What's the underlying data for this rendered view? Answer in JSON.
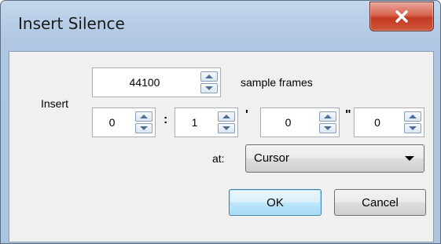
{
  "window": {
    "title": "Insert Silence",
    "close_icon": "close-icon",
    "accent": "#c23a22"
  },
  "form": {
    "insert_label": "Insert",
    "frames": {
      "value": "44100",
      "unit_label": "sample frames"
    },
    "time": {
      "hours": "0",
      "sep1": ":",
      "minutes": "1",
      "sep2": "'",
      "seconds": "0",
      "sep3": "\"",
      "frames": "0"
    },
    "at_label": "at:",
    "at_select": {
      "selected": "Cursor"
    }
  },
  "buttons": {
    "ok": "OK",
    "cancel": "Cancel"
  }
}
